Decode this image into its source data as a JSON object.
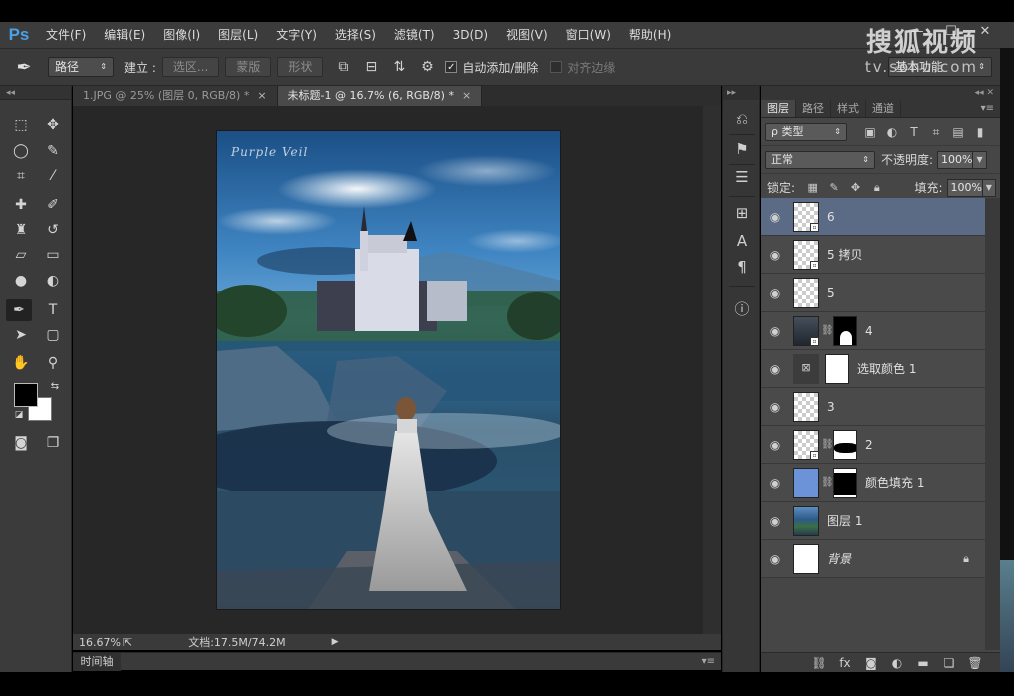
{
  "app": {
    "logo": "Ps"
  },
  "menu": [
    "文件(F)",
    "编辑(E)",
    "图像(I)",
    "图层(L)",
    "文字(Y)",
    "选择(S)",
    "滤镜(T)",
    "3D(D)",
    "视图(V)",
    "窗口(W)",
    "帮助(H)"
  ],
  "window_controls": [
    "—",
    "☐",
    "✕"
  ],
  "watermark": {
    "title": "搜狐视频",
    "url": "tv.sohu.com"
  },
  "options": {
    "mode_select": "路径",
    "build_label": "建立 :",
    "buttons": [
      "选区...",
      "蒙版",
      "形状"
    ],
    "auto_add_delete": "自动添加/删除",
    "align_edges": "对齐边缘",
    "workspace": "基本功能"
  },
  "tabs": [
    {
      "label": "1.JPG @ 25% (图层 0, RGB/8) *",
      "active": false
    },
    {
      "label": "未标题-1 @ 16.7% (6, RGB/8) *",
      "active": true
    }
  ],
  "status": {
    "zoom": "16.67%",
    "doc": "文档:17.5M/74.2M"
  },
  "timeline": {
    "label": "时间轴"
  },
  "layers_panel": {
    "tabs": [
      "图层",
      "路径",
      "样式",
      "通道"
    ],
    "filter_select": "ρ 类型",
    "blend_mode": "正常",
    "opacity_label": "不透明度:",
    "opacity_value": "100%",
    "lock_label": "锁定:",
    "fill_label": "填充:",
    "fill_value": "100%",
    "layers": [
      {
        "name": "6",
        "selected": true
      },
      {
        "name": "5 拷贝",
        "selected": false
      },
      {
        "name": "5",
        "selected": false
      },
      {
        "name": "4",
        "selected": false
      },
      {
        "name": "选取颜色 1",
        "selected": false
      },
      {
        "name": "3",
        "selected": false
      },
      {
        "name": "2",
        "selected": false
      },
      {
        "name": "颜色填充 1",
        "selected": false
      },
      {
        "name": "图层 1",
        "selected": false
      },
      {
        "name": "背景",
        "selected": false
      }
    ]
  },
  "canvas_text": "Purple Veil"
}
